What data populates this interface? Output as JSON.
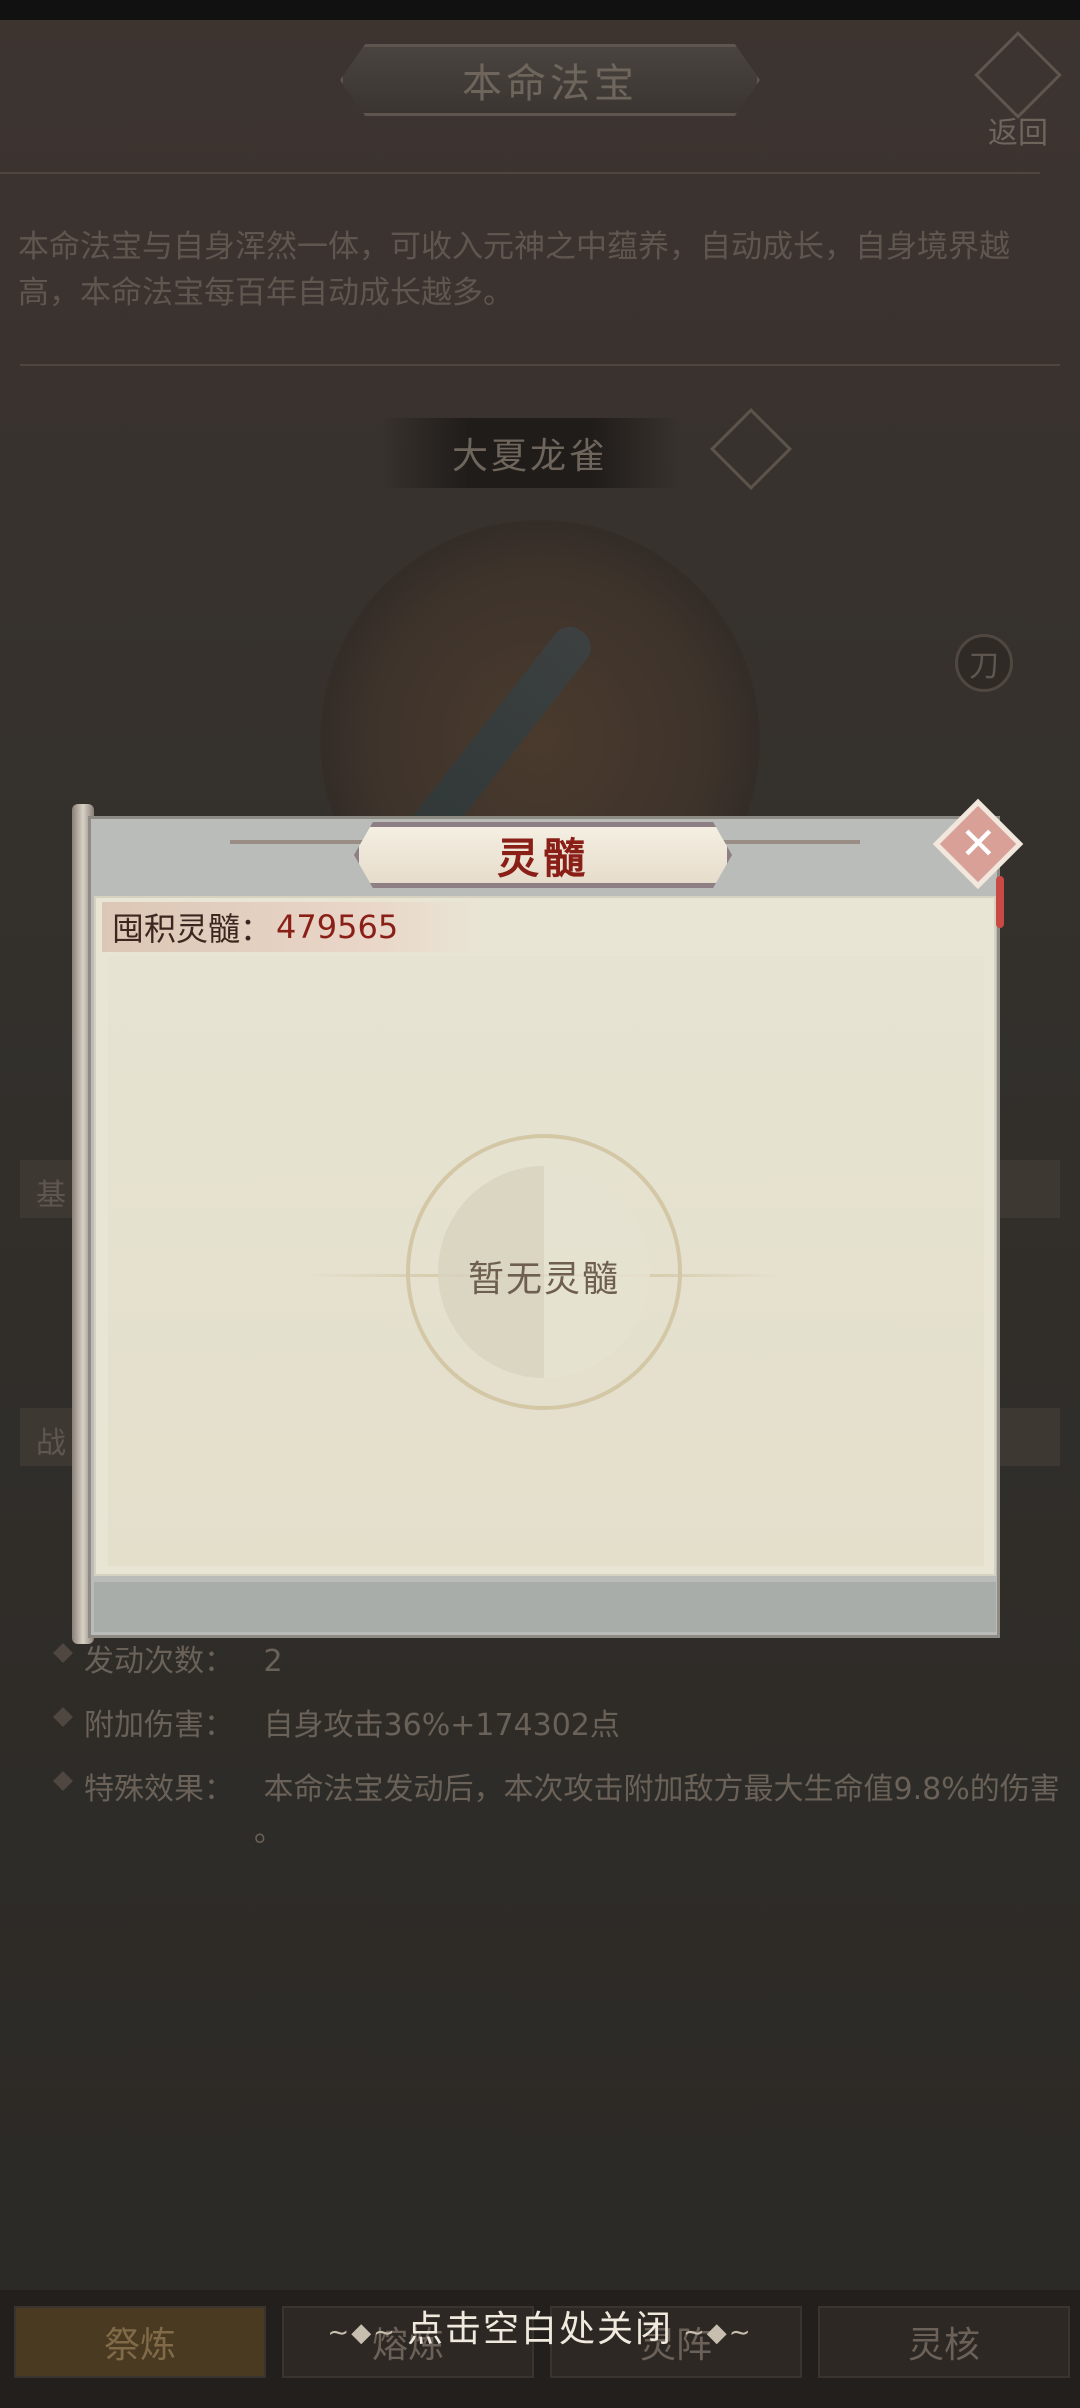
{
  "page": {
    "title": "本命法宝",
    "back_label": "返回",
    "description": "本命法宝与自身浑然一体，可收入元神之中蕴养，自动成长，自身境界越高，本命法宝每百年自动成长越多。",
    "treasure_name": "大夏龙雀",
    "weapon_type": "刀",
    "section_basic": "基",
    "section_battle": "战",
    "stats": [
      {
        "key": "发动次数：",
        "value": "2"
      },
      {
        "key": "附加伤害：",
        "value": "自身攻击36%+174302点"
      },
      {
        "key": "特殊效果：",
        "value": "本命法宝发动后，本次攻击附加敌方最大生命值9.8%的伤害"
      },
      {
        "key": "",
        "value": "。"
      }
    ],
    "tabs": [
      "祭炼",
      "熔炼",
      "灵阵",
      "灵核"
    ],
    "active_tab": 0
  },
  "modal": {
    "title": "灵髓",
    "accum_label": "囤积灵髓：",
    "accum_value": "479565",
    "empty_text": "暂无灵髓",
    "close_hint": "点击空白处关闭",
    "hint_deco_left": "∼◆∼",
    "hint_deco_right": "∼◆∼"
  },
  "colors": {
    "accent_red": "#8a1f18",
    "close_pink": "#d9a098",
    "panel_bg": "#e9e5d5"
  }
}
